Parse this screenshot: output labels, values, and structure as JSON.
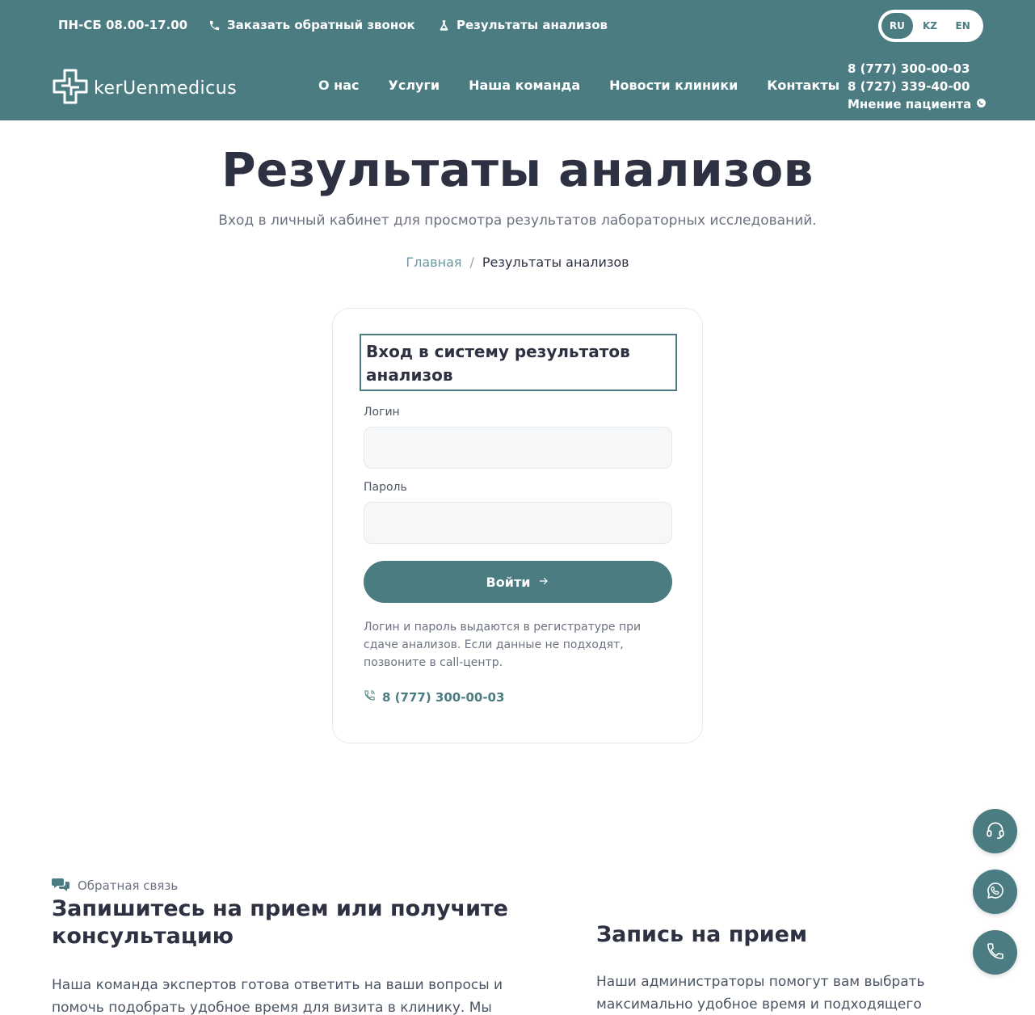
{
  "colors": {
    "brand": "#4a7c82",
    "text": "#2d3142",
    "muted": "#6b7280",
    "link": "#6a9aa0"
  },
  "topbar": {
    "hours": "ПН-СБ 08.00-17.00",
    "callback": "Заказать обратный звонок",
    "results": "Результаты анализов",
    "languages": [
      "RU",
      "KZ",
      "EN"
    ],
    "active_language": "RU"
  },
  "header": {
    "logo_text": "kerUenmedicus",
    "nav": [
      "О нас",
      "Услуги",
      "Наша команда",
      "Новости клиники",
      "Контакты"
    ],
    "phone1": "8 (777) 300-00-03",
    "phone2": "8 (727) 339-40-00",
    "patient_opinion": "Мнение пациента"
  },
  "hero": {
    "title": "Результаты анализов",
    "subtitle": "Вход в личный кабинет для просмотра результатов лабораторных исследований.",
    "breadcrumb_home": "Главная",
    "breadcrumb_sep": "/",
    "breadcrumb_current": "Результаты анализов"
  },
  "login": {
    "title": "Вход в систему результатов анализов",
    "login_label": "Логин",
    "login_value": "",
    "password_label": "Пароль",
    "password_value": "",
    "submit": "Войти",
    "note": "Логин и пароль выдаются в регистратуре при сдаче анализов. Если данные не подходят, позвоните в call-центр.",
    "phone": "8 (777) 300-00-03"
  },
  "floating": [
    "headset-icon",
    "whatsapp-icon",
    "phone-icon"
  ],
  "feedback": {
    "tag": "Обратная связь",
    "title": "Запишитесь на прием или получите консультацию",
    "text": "Наша команда экспертов готова ответить на ваши вопросы и помочь подобрать удобное время для визита в клинику. Мы здесь,"
  },
  "appointment": {
    "title": "Запись на прием",
    "text": "Наши администраторы помогут вам выбрать максимально удобное время и подходящего"
  }
}
